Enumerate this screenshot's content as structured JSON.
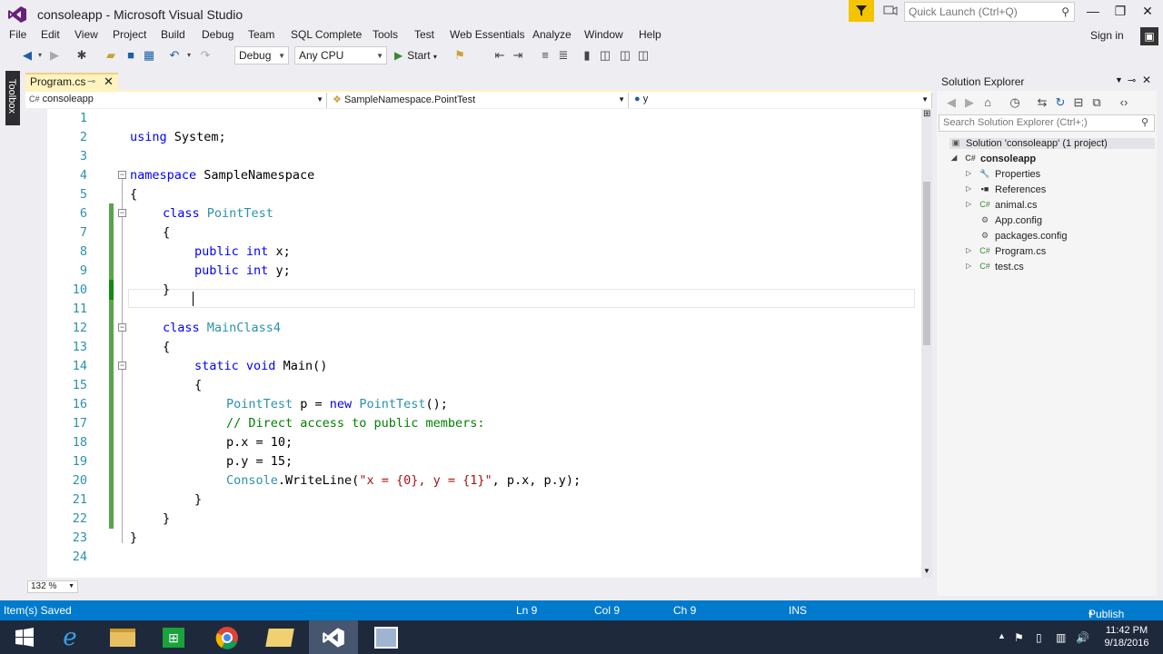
{
  "window": {
    "title": "consoleapp - Microsoft Visual Studio",
    "quick_launch_placeholder": "Quick Launch (Ctrl+Q)"
  },
  "menu": [
    "File",
    "Edit",
    "View",
    "Project",
    "Build",
    "Debug",
    "Team",
    "SQL Complete",
    "Tools",
    "Test",
    "Web Essentials",
    "Analyze",
    "Window",
    "Help"
  ],
  "signin": "Sign in",
  "toolbar": {
    "config": "Debug",
    "platform": "Any CPU",
    "start": "Start"
  },
  "toolbox_label": "Toolbox",
  "editor": {
    "tab": "Program.cs",
    "nav_project": "consoleapp",
    "nav_type": "SampleNamespace.PointTest",
    "nav_member": "y",
    "zoom": "132 %",
    "lines": [
      "1",
      "2",
      "3",
      "4",
      "5",
      "6",
      "7",
      "8",
      "9",
      "10",
      "11",
      "12",
      "13",
      "14",
      "15",
      "16",
      "17",
      "18",
      "19",
      "20",
      "21",
      "22",
      "23",
      "24"
    ]
  },
  "code": {
    "l2": {
      "kw": "using",
      "rest": " System;"
    },
    "l4": {
      "kw": "namespace",
      "rest": " SampleNamespace"
    },
    "brace_open": "{",
    "brace_close": "}",
    "l6": {
      "kw": "class",
      "ty": "PointTest"
    },
    "l8": {
      "kw1": "public",
      "kw2": "int",
      "rest": " x;"
    },
    "l9": {
      "kw1": "public",
      "kw2": "int",
      "rest": " y;"
    },
    "l12": {
      "kw": "class",
      "ty": "MainClass4"
    },
    "l14": {
      "kw1": "static",
      "kw2": "void",
      "rest": " Main()"
    },
    "l16": {
      "ty1": "PointTest",
      "mid": " p = ",
      "kw": "new",
      "ty2": "PointTest",
      "end": "();"
    },
    "l17": {
      "cm": "// Direct access to public members:"
    },
    "l18": {
      "text": "p.x = 10;"
    },
    "l19": {
      "text": "p.y = 15;"
    },
    "l20": {
      "ty": "Console",
      "mid": ".WriteLine(",
      "st": "\"x = {0}, y = {1}\"",
      "end": ", p.x, p.y);"
    }
  },
  "solution_explorer": {
    "title": "Solution Explorer",
    "search_placeholder": "Search Solution Explorer (Ctrl+;)",
    "solution": "Solution 'consoleapp' (1 project)",
    "project": "consoleapp",
    "items": [
      "Properties",
      "References",
      "animal.cs",
      "App.config",
      "packages.config",
      "Program.cs",
      "test.cs"
    ]
  },
  "status": {
    "message": "Item(s) Saved",
    "ln": "Ln 9",
    "col": "Col 9",
    "ch": "Ch 9",
    "ins": "INS",
    "publish": "Publish"
  },
  "clock": {
    "time": "11:42 PM",
    "date": "9/18/2016"
  },
  "colors": {
    "accent": "#007acc",
    "vs_purple": "#68217a",
    "keyword": "#0000ff",
    "type": "#2b91af",
    "comment": "#008000",
    "string": "#a31515"
  }
}
